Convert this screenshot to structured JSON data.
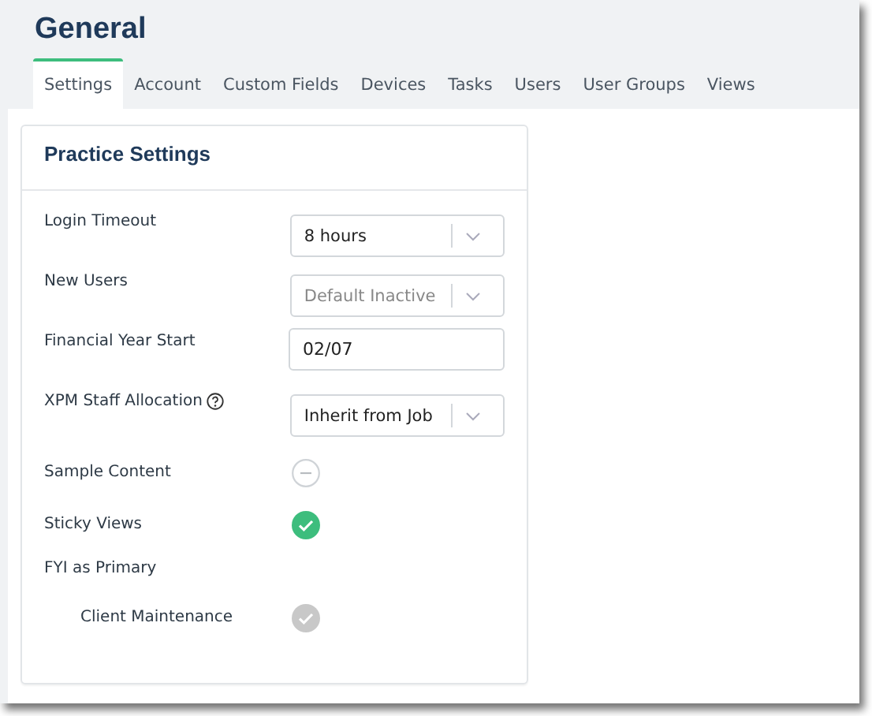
{
  "page": {
    "title": "General"
  },
  "tabs": [
    {
      "label": "Settings",
      "selected": true
    },
    {
      "label": "Account",
      "selected": false
    },
    {
      "label": "Custom Fields",
      "selected": false
    },
    {
      "label": "Devices",
      "selected": false
    },
    {
      "label": "Tasks",
      "selected": false
    },
    {
      "label": "Users",
      "selected": false
    },
    {
      "label": "User Groups",
      "selected": false
    },
    {
      "label": "Views",
      "selected": false
    }
  ],
  "card": {
    "title": "Practice Settings",
    "rows": [
      {
        "kind": "select",
        "label": "Login Timeout",
        "value": "8 hours",
        "disabled": false
      },
      {
        "kind": "select",
        "label": "New Users",
        "value": "Default Inactive",
        "disabled": true
      },
      {
        "kind": "text",
        "label": "Financial Year Start",
        "value": "02/07"
      },
      {
        "kind": "select",
        "label": "XPM Staff Allocation",
        "help": true,
        "value": "Inherit from Job",
        "disabled": false
      },
      {
        "kind": "toggle",
        "label": "Sample Content",
        "on": false,
        "disabled": false
      },
      {
        "kind": "toggle",
        "label": "Sticky Views",
        "on": true,
        "disabled": false
      },
      {
        "kind": "group",
        "label": "FYI as Primary",
        "children": [
          {
            "kind": "toggle",
            "label": "Client Maintenance",
            "on": true,
            "disabled": true
          }
        ]
      }
    ]
  }
}
